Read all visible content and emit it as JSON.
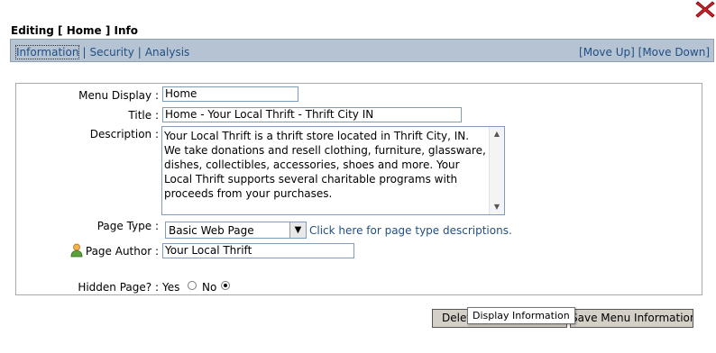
{
  "page": {
    "title": "Editing [ Home ] Info"
  },
  "tabs": {
    "items": [
      {
        "label": "Information"
      },
      {
        "label": "Security"
      },
      {
        "label": "Analysis"
      }
    ],
    "separator": "|",
    "move_up": "[Move Up]",
    "move_down": "[Move Down]"
  },
  "form": {
    "menu_display": {
      "label": "Menu Display :",
      "value": "Home"
    },
    "title": {
      "label": "Title :",
      "value": "Home - Your Local Thrift - Thrift City IN"
    },
    "description": {
      "label": "Description :",
      "value": "Your Local Thrift is a thrift store located in Thrift City, IN.  We take donations and resell clothing, furniture, glassware, dishes, collectibles, accessories, shoes and more. Your Local Thrift supports several charitable programs with proceeds from your purchases."
    },
    "page_type": {
      "label": "Page Type :",
      "selected": "Basic Web Page",
      "help_link": "Click here for page type descriptions."
    },
    "page_author": {
      "label": "Page Author :",
      "value": "Your Local Thrift"
    },
    "hidden_page": {
      "label": "Hidden Page? :",
      "yes": "Yes",
      "no": "No",
      "selected": "No"
    }
  },
  "buttons": {
    "delete_label": "Delet",
    "save_label": "Save Menu Information"
  },
  "tooltip": {
    "text": "Display Information"
  },
  "colors": {
    "tabbar_bg": "#b6c3d2",
    "link": "#1f4f86",
    "close_red": "#d8232a"
  }
}
